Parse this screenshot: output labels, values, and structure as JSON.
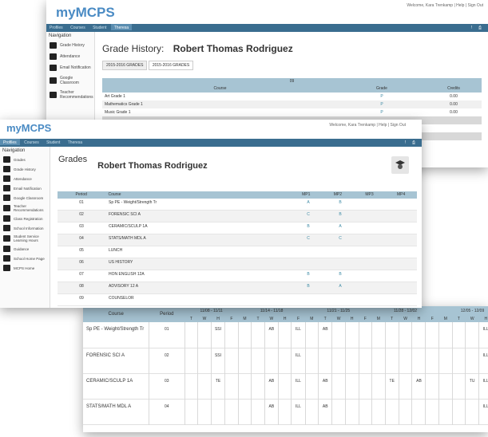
{
  "window1": {
    "logo": "myMCPS",
    "welcome": "Welcome, Kara Trenkamp",
    "help": "Help",
    "sign_out": "Sign Out",
    "topnav": [
      "Profiles",
      "Courses",
      "Student",
      "Theresa"
    ],
    "nav_title": "Navigation",
    "nav_items": [
      "Grade History",
      "Attendance",
      "Email Notification",
      "Google Classroom",
      "Teacher Recommendations"
    ],
    "page_label": "Grade History:",
    "student_name": "Robert Thomas Rodriguez",
    "tabs": [
      "2015-2016 GRADES",
      "2015-2016 GRADES"
    ],
    "grade_group": "09",
    "columns": [
      "Course",
      "Grade",
      "Credits"
    ],
    "rows": [
      {
        "course": "Art Grade 1",
        "grade": "P",
        "credits": "0.00"
      },
      {
        "course": "Mathematics Grade 1",
        "grade": "P",
        "credits": "0.00"
      },
      {
        "course": "Music Grade 1",
        "grade": "P",
        "credits": "0.00"
      }
    ]
  },
  "window2": {
    "logo": "myMCPS",
    "welcome": "Welcome, Kara Trenkamp",
    "help": "Help",
    "sign_out": "Sign Out",
    "topnav": [
      "Profiles",
      "Courses",
      "Student",
      "Theresa"
    ],
    "nav_title": "Navigation",
    "nav_items": [
      "Grades",
      "Grade History",
      "Attendance",
      "Email Notification",
      "Google Classroom",
      "Teacher Recommendations",
      "Class Registration",
      "School Information",
      "Student Service Learning Hours",
      "Guidance",
      "School Home Page",
      "MCPS Home"
    ],
    "page_label": "Grades",
    "student_name": "Robert Thomas Rodriguez",
    "columns": [
      "Period",
      "Course",
      "MP1",
      "MP2",
      "MP3",
      "MP4"
    ],
    "rows": [
      {
        "period": "01",
        "course": "Sp PE - Weight/Strength Tr",
        "mp1": "A",
        "mp2": "B"
      },
      {
        "period": "02",
        "course": "FORENSIC SCI A",
        "mp1": "C",
        "mp2": "B"
      },
      {
        "period": "03",
        "course": "CERAMIC/SCULP 1A",
        "mp1": "B",
        "mp2": "A"
      },
      {
        "period": "04",
        "course": "STATS/MATH MDL A",
        "mp1": "C",
        "mp2": "C"
      },
      {
        "period": "05",
        "course": "LUNCH",
        "mp1": "",
        "mp2": ""
      },
      {
        "period": "06",
        "course": "US HISTORY",
        "mp1": "",
        "mp2": ""
      },
      {
        "period": "07",
        "course": "HON ENGLISH 12A",
        "mp1": "B",
        "mp2": "B"
      },
      {
        "period": "08",
        "course": "ADVISORY 12 A",
        "mp1": "B",
        "mp2": "A"
      },
      {
        "period": "09",
        "course": "COUNSELOR",
        "mp1": "",
        "mp2": ""
      }
    ]
  },
  "window3": {
    "course_header": "Course",
    "period_header": "Period",
    "weeks": [
      "11/08 - 11/11",
      "11/14 - 11/18",
      "11/21 - 11/25",
      "11/28 - 12/02",
      "12/05 - 12/09"
    ],
    "days": [
      "T",
      "W",
      "H",
      "F",
      "M",
      "T",
      "W",
      "H",
      "F",
      "M",
      "T",
      "W",
      "H",
      "F",
      "M",
      "T",
      "W",
      "H",
      "F",
      "M",
      "T",
      "W",
      "H",
      "F"
    ],
    "rows": [
      {
        "course": "Sp PE - Weight/Strength Tr",
        "period": "01",
        "cells": [
          "",
          "",
          "SSI",
          "",
          "",
          "",
          "AB",
          "",
          "ILL",
          "",
          "AB",
          "",
          "",
          "",
          "",
          "",
          "",
          "",
          "",
          "",
          "",
          "",
          "ILL",
          ""
        ]
      },
      {
        "course": "FORENSIC SCI A",
        "period": "02",
        "cells": [
          "",
          "",
          "SSI",
          "",
          "",
          "",
          "",
          "",
          "ILL",
          "",
          "",
          "",
          "",
          "",
          "",
          "",
          "",
          "",
          "",
          "",
          "",
          "",
          "ILL",
          ""
        ]
      },
      {
        "course": "CERAMIC/SCULP 1A",
        "period": "03",
        "cells": [
          "",
          "",
          "TE",
          "",
          "",
          "",
          "AB",
          "",
          "ILL",
          "",
          "AB",
          "",
          "",
          "",
          "",
          "TE",
          "",
          "AB",
          "",
          "",
          "",
          "TU",
          "ILL",
          ""
        ]
      },
      {
        "course": "STATS/MATH MDL A",
        "period": "04",
        "cells": [
          "",
          "",
          "",
          "",
          "",
          "",
          "AB",
          "",
          "ILL",
          "",
          "AB",
          "",
          "",
          "",
          "",
          "",
          "",
          "",
          "",
          "",
          "",
          "",
          "ILL",
          ""
        ]
      }
    ]
  },
  "colors": {
    "brand": "#4a8bc4",
    "nav": "#3a6d8f",
    "table_header": "#a7c4d3"
  }
}
